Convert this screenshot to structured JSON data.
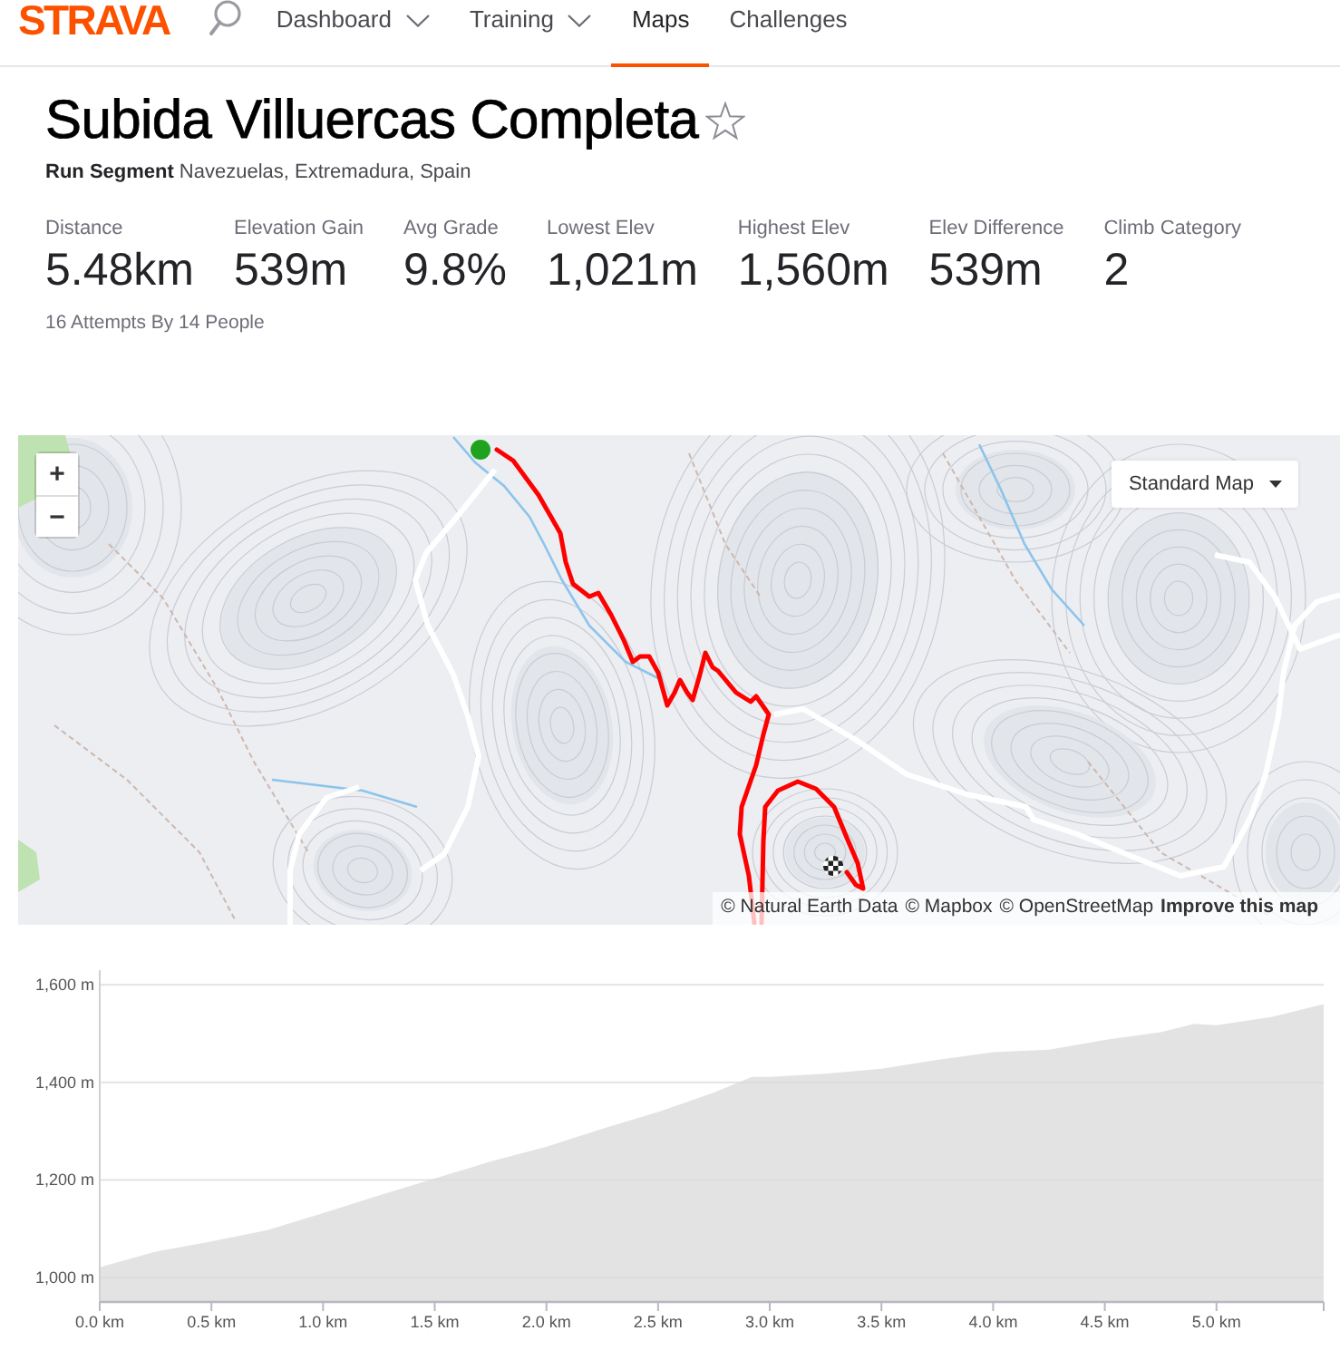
{
  "header": {
    "logo": "STRAVA",
    "nav": [
      {
        "label": "Dashboard",
        "kind": "dropdown",
        "selected": false
      },
      {
        "label": "Training",
        "kind": "dropdown",
        "selected": false
      },
      {
        "label": "Maps",
        "kind": "link",
        "selected": true
      },
      {
        "label": "Challenges",
        "kind": "link",
        "selected": false
      }
    ]
  },
  "segment": {
    "title": "Subida Villuercas Completa",
    "starred": false,
    "type": "Run Segment",
    "location": "Navezuelas, Extremadura, Spain",
    "stats": [
      {
        "label": "Distance",
        "value": "5.48km"
      },
      {
        "label": "Elevation Gain",
        "value": "539m"
      },
      {
        "label": "Avg Grade",
        "value": "9.8%"
      },
      {
        "label": "Lowest Elev",
        "value": "1,021m"
      },
      {
        "label": "Highest Elev",
        "value": "1,560m"
      },
      {
        "label": "Elev Difference",
        "value": "539m"
      },
      {
        "label": "Climb Category",
        "value": "2"
      }
    ],
    "attempts": "16 Attempts By 14 People"
  },
  "map": {
    "zoom_in": "+",
    "zoom_out": "−",
    "style_menu": "Standard Map",
    "attribution": [
      {
        "text": "© Natural Earth Data",
        "kind": "credit"
      },
      {
        "text": "© Mapbox",
        "kind": "credit"
      },
      {
        "text": "© OpenStreetMap",
        "kind": "credit"
      },
      {
        "text": "Improve this map",
        "kind": "action"
      }
    ]
  },
  "elevation_chart": {
    "chart_data": {
      "type": "area",
      "grid": true,
      "x": [
        0,
        0.25,
        0.5,
        0.75,
        1.0,
        1.25,
        1.5,
        1.75,
        2.0,
        2.25,
        2.5,
        2.75,
        2.92,
        3.0,
        3.25,
        3.5,
        3.75,
        4.0,
        4.25,
        4.5,
        4.75,
        4.9,
        5.0,
        5.25,
        5.48
      ],
      "series": [
        {
          "color": "#e3e3e3",
          "values": [
            1021,
            1053,
            1074,
            1097,
            1132,
            1168,
            1203,
            1238,
            1268,
            1305,
            1339,
            1379,
            1411,
            1411,
            1418,
            1428,
            1446,
            1462,
            1467,
            1487,
            1503,
            1520,
            1517,
            1534,
            1560
          ]
        }
      ],
      "xlim": [
        0,
        5.48
      ],
      "ylim": [
        950,
        1630
      ],
      "xticks": [
        {
          "value": 0,
          "label": "0.0 km"
        },
        {
          "value": 0.5,
          "label": "0.5 km"
        },
        {
          "value": 1,
          "label": "1.0 km"
        },
        {
          "value": 1.5,
          "label": "1.5 km"
        },
        {
          "value": 2,
          "label": "2.0 km"
        },
        {
          "value": 2.5,
          "label": "2.5 km"
        },
        {
          "value": 3,
          "label": "3.0 km"
        },
        {
          "value": 3.5,
          "label": "3.5 km"
        },
        {
          "value": 4,
          "label": "4.0 km"
        },
        {
          "value": 4.5,
          "label": "4.5 km"
        },
        {
          "value": 5,
          "label": "5.0 km"
        }
      ],
      "yticks": [
        {
          "value": 1000,
          "label": "1,000 m"
        },
        {
          "value": 1200,
          "label": "1,200 m"
        },
        {
          "value": 1400,
          "label": "1,400 m"
        },
        {
          "value": 1600,
          "label": "1,600 m"
        }
      ]
    }
  }
}
